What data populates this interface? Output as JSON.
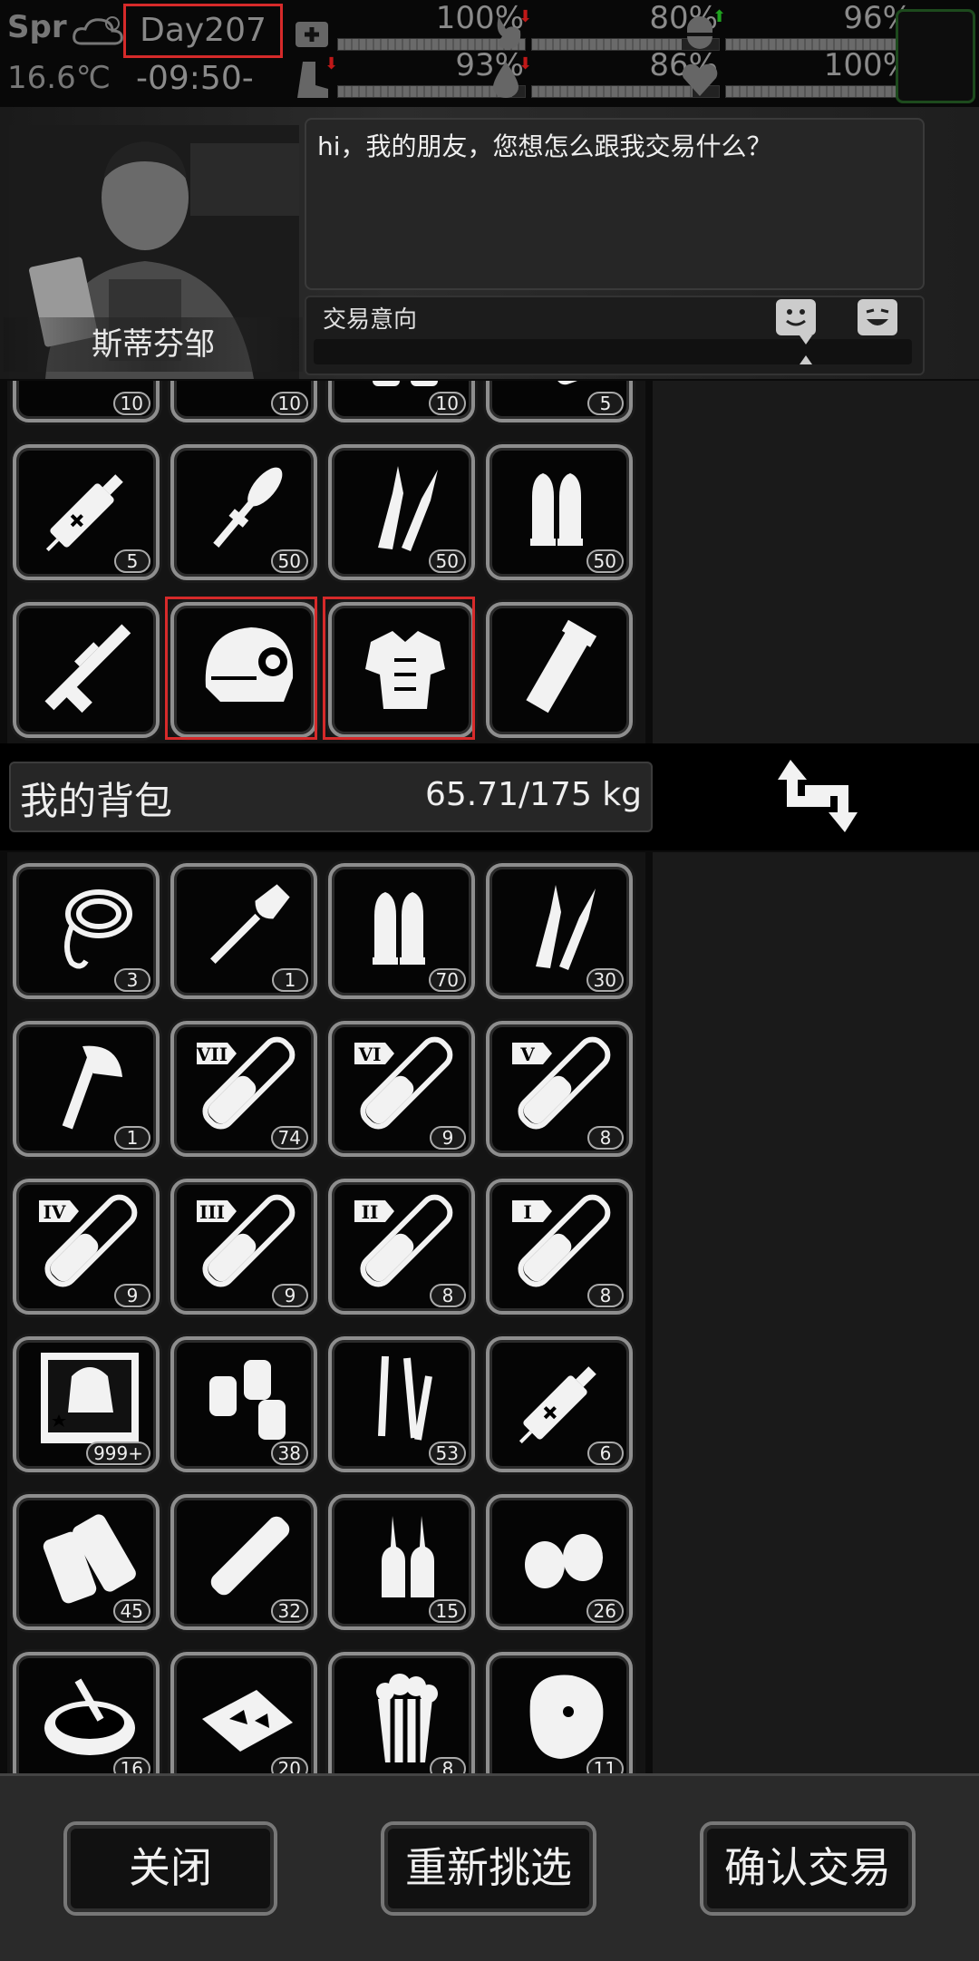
{
  "status": {
    "season": "Spr",
    "temperature": "16.6℃",
    "day": "Day207",
    "time": "-09:50-",
    "stats": [
      {
        "name": "health",
        "icon": "medkit-icon",
        "percent": "100%",
        "level": 1.0,
        "arrow": ""
      },
      {
        "name": "hunger",
        "icon": "stomach-icon",
        "percent": "80%",
        "level": 0.8,
        "arrow": "down"
      },
      {
        "name": "stamina",
        "icon": "pill-icon",
        "percent": "96%",
        "level": 0.96,
        "arrow": "up"
      },
      {
        "name": "fatigue",
        "icon": "boot-icon",
        "percent": "93%",
        "level": 0.93,
        "arrow": "down"
      },
      {
        "name": "thirst",
        "icon": "water-drop-icon",
        "percent": "86%",
        "level": 0.86,
        "arrow": "down"
      },
      {
        "name": "mood",
        "icon": "heart-icon",
        "percent": "100%",
        "level": 1.0,
        "arrow": ""
      }
    ]
  },
  "npc": {
    "name": "斯蒂芬邹",
    "dialog": "hi，我的朋友，您想怎么跟我交易什么？",
    "intent_label": "交易意向"
  },
  "merchant": {
    "items": [
      {
        "icon": "ration-can-icon",
        "count": "10"
      },
      {
        "icon": "flour-bag-icon",
        "count": "10"
      },
      {
        "icon": "spray-bottles-icon",
        "count": "10"
      },
      {
        "icon": "tube-icon",
        "count": "5"
      },
      {
        "icon": "syringe-icon",
        "count": "5"
      },
      {
        "icon": "rpg-rocket-icon",
        "count": "50"
      },
      {
        "icon": "rifle-rounds-icon",
        "count": "50"
      },
      {
        "icon": "pistol-rounds-icon",
        "count": "50"
      },
      {
        "icon": "rifle-weapon-icon",
        "count": ""
      },
      {
        "icon": "tactical-helmet-icon",
        "count": ""
      },
      {
        "icon": "body-armor-icon",
        "count": ""
      },
      {
        "icon": "grenade-launcher-icon",
        "count": ""
      }
    ]
  },
  "backpack": {
    "title": "我的背包",
    "weight": "65.71/175 kg",
    "items": [
      {
        "icon": "rope-icon",
        "count": "3"
      },
      {
        "icon": "shovel-icon",
        "count": "1"
      },
      {
        "icon": "pistol-rounds-icon",
        "count": "70"
      },
      {
        "icon": "rifle-rounds-icon",
        "count": "30"
      },
      {
        "icon": "axe-icon",
        "count": "1"
      },
      {
        "icon": "vial-vii-icon",
        "count": "74",
        "label": "VII"
      },
      {
        "icon": "vial-vi-icon",
        "count": "9",
        "label": "VI"
      },
      {
        "icon": "vial-v-icon",
        "count": "8",
        "label": "V"
      },
      {
        "icon": "vial-iv-icon",
        "count": "9",
        "label": "IV"
      },
      {
        "icon": "vial-iii-icon",
        "count": "9",
        "label": "III"
      },
      {
        "icon": "vial-ii-icon",
        "count": "8",
        "label": "II"
      },
      {
        "icon": "vial-i-icon",
        "count": "8",
        "label": "I"
      },
      {
        "icon": "zombie-poster-icon",
        "count": "999+"
      },
      {
        "icon": "spray-cans-icon",
        "count": "38"
      },
      {
        "icon": "test-tubes-icon",
        "count": "53"
      },
      {
        "icon": "syringe-icon",
        "count": "6"
      },
      {
        "icon": "bandage-icon",
        "count": "45"
      },
      {
        "icon": "wrapped-stick-icon",
        "count": "32"
      },
      {
        "icon": "ampoules-icon",
        "count": "15"
      },
      {
        "icon": "nuts-icon",
        "count": "26"
      },
      {
        "icon": "soup-bowl-icon",
        "count": "16"
      },
      {
        "icon": "chips-tray-icon",
        "count": "20"
      },
      {
        "icon": "popcorn-icon",
        "count": "8"
      },
      {
        "icon": "steak-icon",
        "count": "11"
      }
    ]
  },
  "buttons": {
    "close": "关闭",
    "reselect": "重新挑选",
    "confirm": "确认交易"
  }
}
